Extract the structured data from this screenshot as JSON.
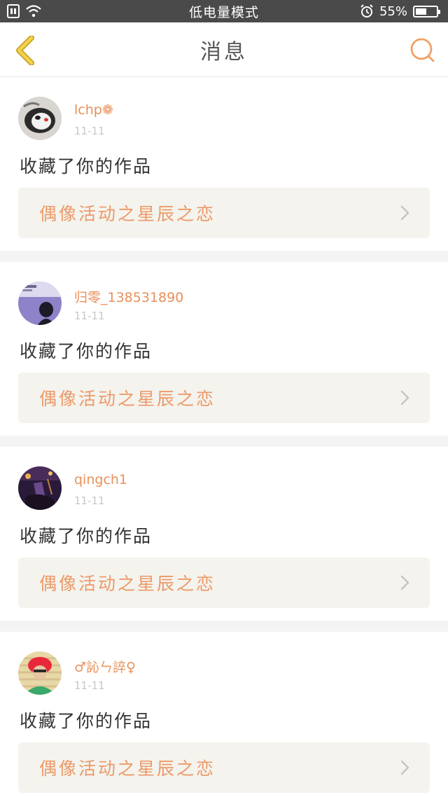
{
  "status_bar": {
    "mode_text": "低电量模式",
    "battery_percent": "55%",
    "battery_level": 0.55,
    "icons": [
      "sim-icon",
      "wifi-icon",
      "alarm-icon",
      "battery-icon"
    ]
  },
  "header": {
    "title": "消息",
    "back_icon": "back-chevron-icon",
    "search_icon": "search-icon",
    "accent_color": "#f0a066",
    "back_color": "#e9c23a"
  },
  "messages": [
    {
      "username": "lchp❁",
      "date": "11-11",
      "action": "收藏了你的作品",
      "work_title": "偶像活动之星辰之恋",
      "avatar": "avatar-dog"
    },
    {
      "username": "归零_138531890",
      "date": "11-11",
      "action": "收藏了你的作品",
      "work_title": "偶像活动之星辰之恋",
      "avatar": "avatar-purple"
    },
    {
      "username": "qingch1",
      "date": "11-11",
      "action": "收藏了你的作品",
      "work_title": "偶像活动之星辰之恋",
      "avatar": "avatar-night"
    },
    {
      "username": "♂訫ㄣ誶♀",
      "date": "11-11",
      "action": "收藏了你的作品",
      "work_title": "偶像活动之星辰之恋",
      "avatar": "avatar-red-hair"
    }
  ]
}
